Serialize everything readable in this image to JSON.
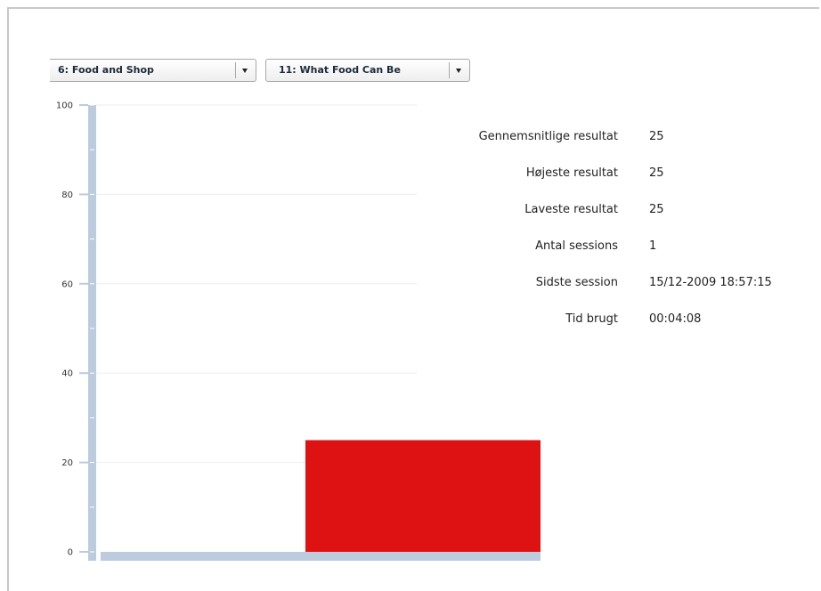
{
  "dropdowns": [
    {
      "selected": "6:  Food and Shop"
    },
    {
      "selected": "11:  What Food Can Be"
    }
  ],
  "stats": [
    {
      "label": "Gennemsnitlige resultat",
      "value": "25"
    },
    {
      "label": "Højeste resultat",
      "value": "25"
    },
    {
      "label": "Laveste resultat",
      "value": "25"
    },
    {
      "label": "Antal sessions",
      "value": "1"
    },
    {
      "label": "Sidste session",
      "value": "15/12-2009 18:57:15"
    },
    {
      "label": "Tid brugt",
      "value": "00:04:08"
    }
  ],
  "colors": {
    "bar": "#de1212",
    "axis": "#bccbdd",
    "grid": "#eeeeee"
  },
  "chart_data": {
    "type": "bar",
    "categories": [
      ""
    ],
    "values": [
      25
    ],
    "ylim": [
      0,
      100
    ],
    "yticks": [
      0,
      20,
      40,
      60,
      80,
      100
    ],
    "grid": true
  }
}
